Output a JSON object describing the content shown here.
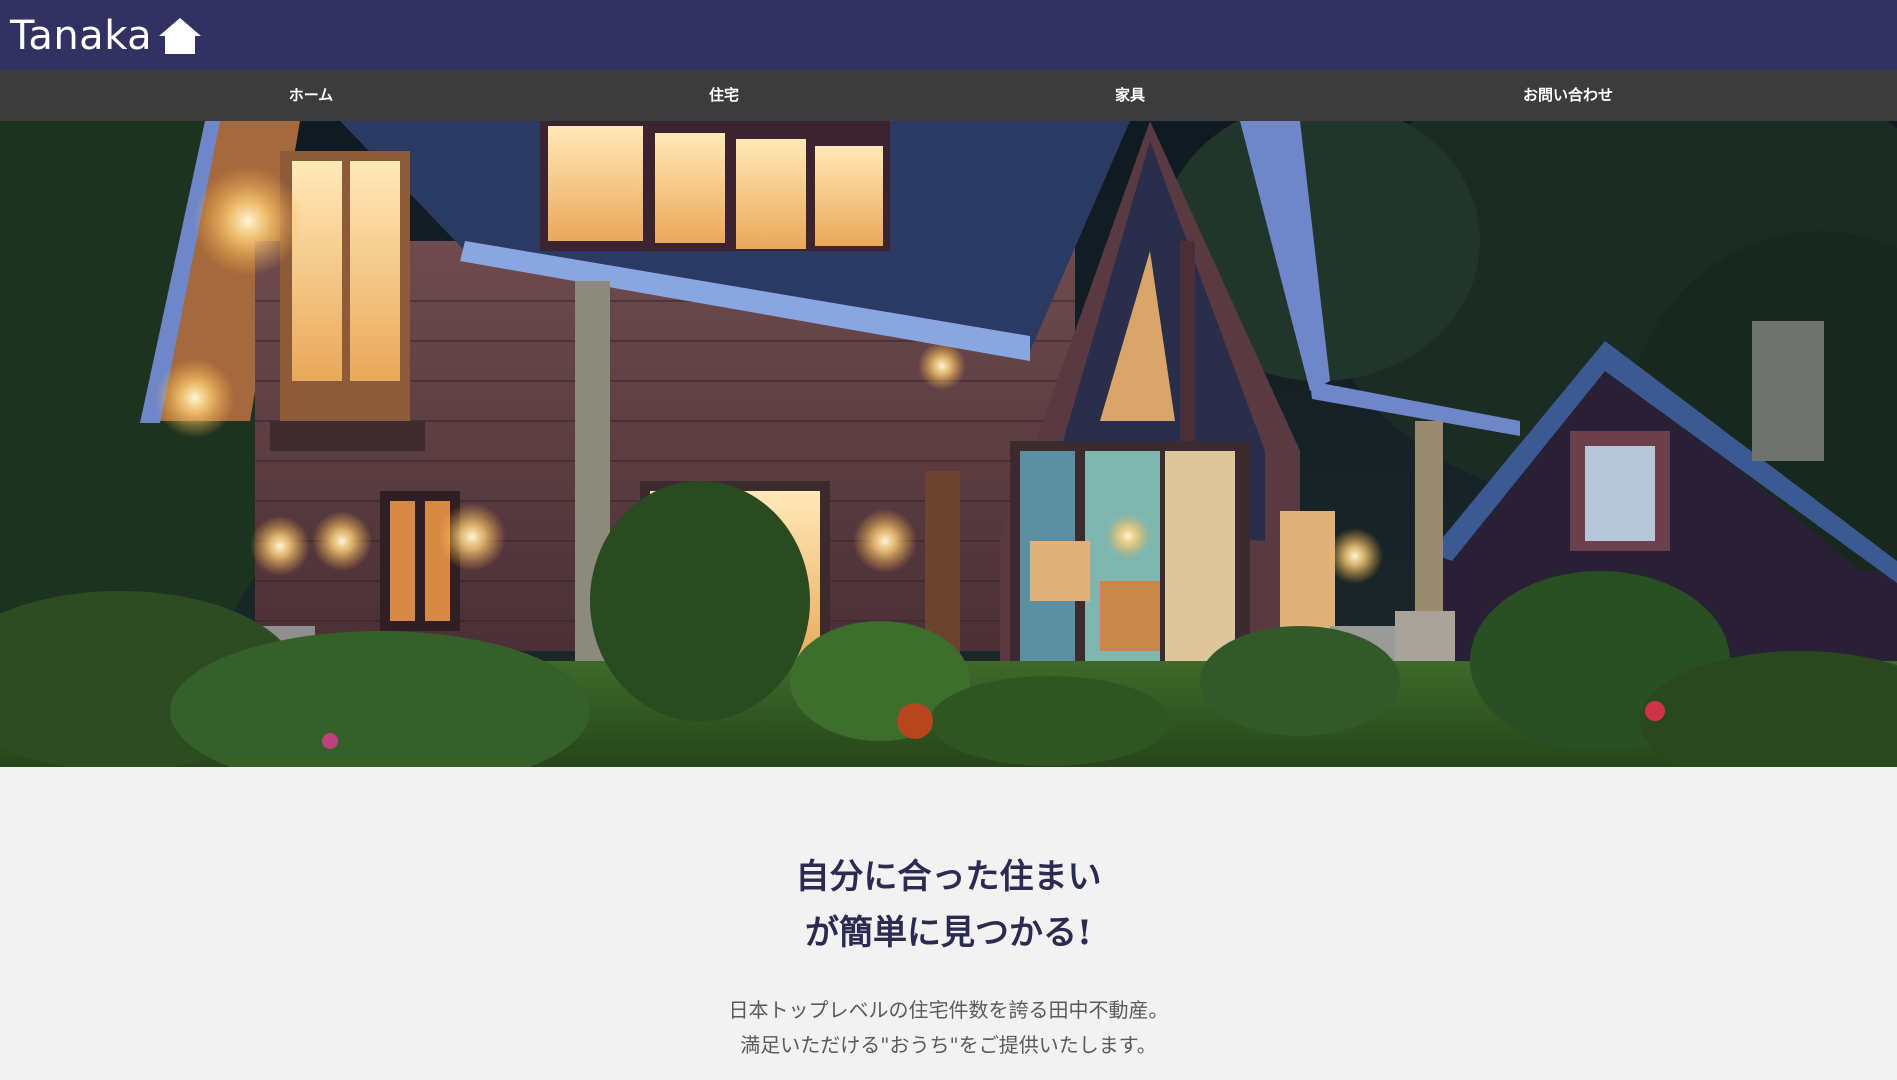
{
  "brand": {
    "name": "Tanaka",
    "icon": "home-icon",
    "header_color": "#313162"
  },
  "nav": {
    "items": [
      {
        "label": "ホーム"
      },
      {
        "label": "住宅"
      },
      {
        "label": "家具"
      },
      {
        "label": "お問い合わせ"
      }
    ],
    "bar_color": "#3c3c3c"
  },
  "hero": {
    "subject": "hero-house-photo"
  },
  "intro": {
    "headline_line1": "自分に合った住まい",
    "headline_line2": "が簡単に見つかる!",
    "lead_line1": "日本トップレベルの住宅件数を誇る田中不動産。",
    "lead_line2": "満足いただける\"おうち\"をご提供いたします。"
  }
}
